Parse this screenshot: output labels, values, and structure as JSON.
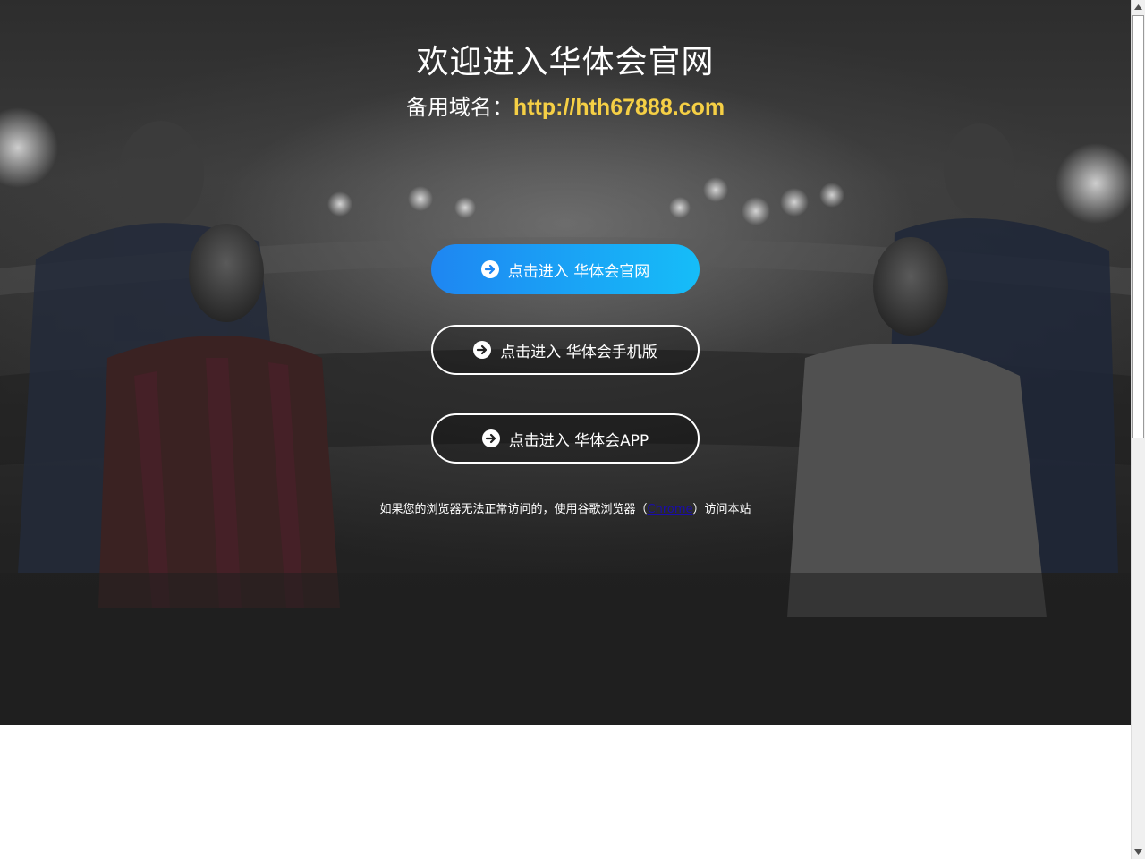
{
  "header": {
    "title": "欢迎进入华体会官网",
    "backup_label": "备用域名：",
    "backup_domain": "http://hth67888.com"
  },
  "buttons": {
    "official": {
      "label": "点击进入 华体会官网",
      "icon": "arrow-right-circle-icon"
    },
    "mobile": {
      "label": "点击进入 华体会手机版",
      "icon": "arrow-right-circle-icon"
    },
    "app": {
      "label": "点击进入 华体会APP",
      "icon": "arrow-right-circle-icon"
    }
  },
  "notice": {
    "prefix": "如果您的浏览器无法正常访问的，使用谷歌浏览器（",
    "link": "Chrome",
    "suffix": "）访问本站"
  },
  "colors": {
    "domain_accent": "#f5cf45",
    "primary_button_start": "#1e86f2",
    "primary_button_end": "#16bdf8",
    "link": "#1a0dab"
  }
}
